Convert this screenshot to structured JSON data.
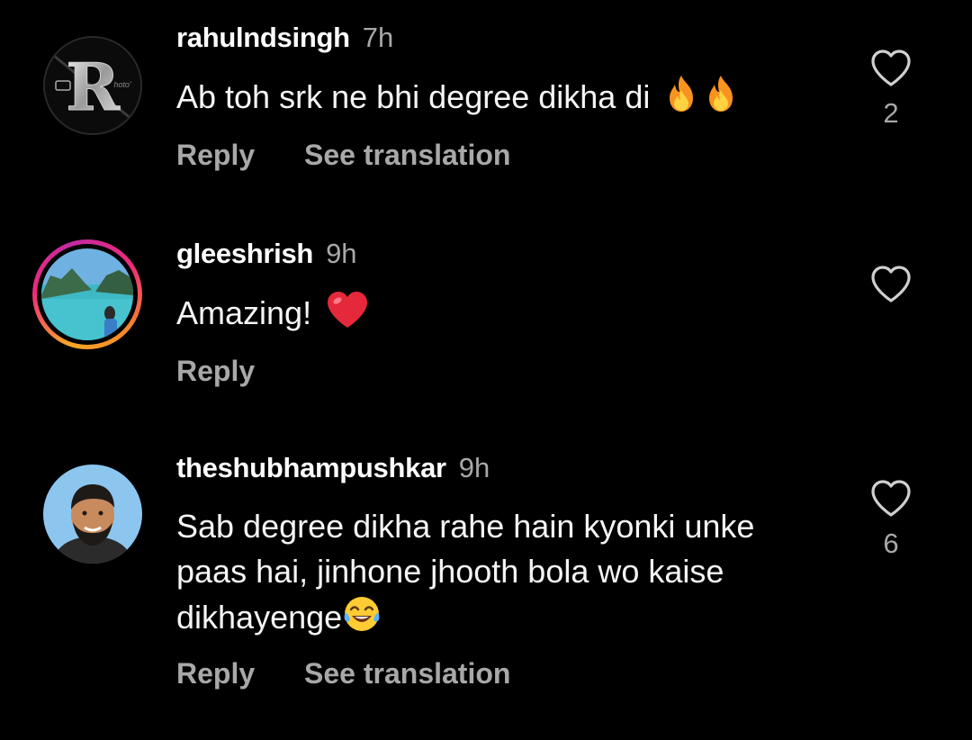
{
  "colors": {
    "background": "#000000",
    "text_primary": "#f5f5f5",
    "text_secondary": "#a8a8a8",
    "story_ring_start": "#f9a826",
    "story_ring_end": "#c32aa3"
  },
  "comments": [
    {
      "username": "rahulndsingh",
      "time": "7h",
      "text": "Ab toh srk ne bhi degree dikha di",
      "emojis": [
        "fire-emoji",
        "fire-emoji"
      ],
      "reply_label": "Reply",
      "translation_label": "See translation",
      "likes": "2",
      "avatar_icon": "letter-r-avatar"
    },
    {
      "username": "gleeshrish",
      "time": "9h",
      "text": "Amazing!",
      "emojis": [
        "red-heart-emoji"
      ],
      "reply_label": "Reply",
      "likes": "",
      "avatar_icon": "beach-photo-avatar",
      "has_story": true
    },
    {
      "username": "theshubhampushkar",
      "time": "9h",
      "text_line1": "Sab degree dikha rahe hain kyonki unke",
      "text_line2": "paas hai, jinhone jhooth bola wo kaise",
      "text_line3": "dikhayenge",
      "emojis": [
        "tears-of-joy-emoji"
      ],
      "reply_label": "Reply",
      "translation_label": "See translation",
      "likes": "6",
      "avatar_icon": "man-photo-avatar"
    }
  ]
}
